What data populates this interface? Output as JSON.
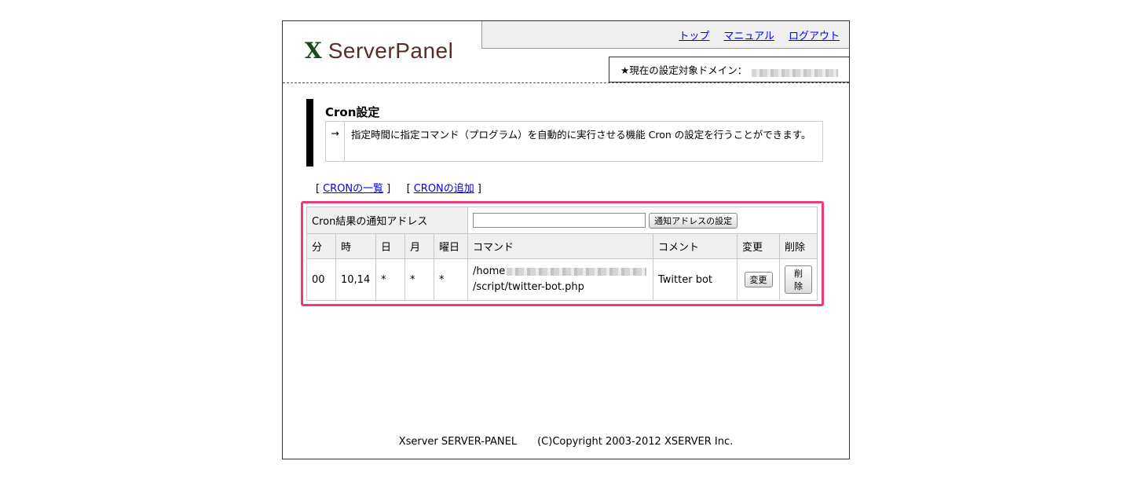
{
  "brand": {
    "mark": "X",
    "name": "ServerPanel"
  },
  "nav": {
    "top": "トップ",
    "manual": "マニュアル",
    "logout": "ログアウト"
  },
  "domain": {
    "label": "★現在の設定対象ドメイン："
  },
  "section": {
    "title": "Cron設定",
    "arrow": "→",
    "description": "指定時間に指定コマンド（プログラム）を自動的に実行させる機能 Cron の設定を行うことができます。"
  },
  "links": {
    "open": "[",
    "close": "]",
    "list": "CRONの一覧",
    "add": "CRONの追加"
  },
  "notify": {
    "label": "Cron結果の通知アドレス",
    "input_value": "",
    "button": "通知アドレスの設定"
  },
  "table": {
    "headers": [
      "分",
      "時",
      "日",
      "月",
      "曜日",
      "コマンド",
      "コメント",
      "変更",
      "削除"
    ],
    "rows": [
      {
        "minute": "00",
        "hour": "10,14",
        "day": "*",
        "month": "*",
        "weekday": "*",
        "command_prefix": "/home",
        "command_suffix": "/script/twitter-bot.php",
        "comment": "Twitter bot",
        "edit_label": "変更",
        "delete_label": "削除"
      }
    ]
  },
  "footer": {
    "product": "Xserver SERVER-PANEL",
    "copyright": "(C)Copyright 2003-2012 XSERVER Inc."
  },
  "colors": {
    "highlight": "#ee3c77",
    "logo_mark": "#174a1e",
    "logo_text": "#5a2c2c",
    "link": "#0000ee"
  }
}
